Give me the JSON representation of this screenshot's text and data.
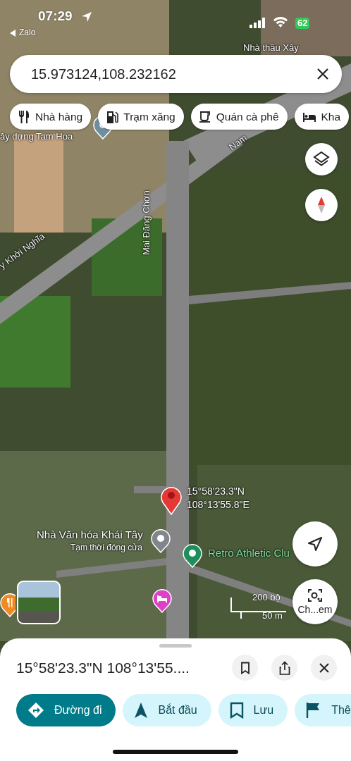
{
  "status_bar": {
    "time": "07:29",
    "back_label": "Zalo",
    "battery": "62"
  },
  "search": {
    "value": "15.973124,108.232162"
  },
  "chips": [
    {
      "kind": "restaurant",
      "label": "Nhà hàng"
    },
    {
      "kind": "gas",
      "label": "Trạm xăng"
    },
    {
      "kind": "cafe",
      "label": "Quán cà phê"
    },
    {
      "kind": "hotel",
      "label": "Kha"
    }
  ],
  "map": {
    "labels": [
      {
        "kind": "place",
        "text": "Nhà thầu Xây"
      },
      {
        "kind": "place",
        "text": "ây dựng Tam Hoa"
      },
      {
        "kind": "road",
        "text": "y Khởi Nghĩa"
      },
      {
        "kind": "road",
        "text": "Mai Đăng Chơn"
      },
      {
        "kind": "road",
        "text": "Nam"
      }
    ],
    "pins": [
      {
        "kind": "poi",
        "color": "#6f8ea0"
      },
      {
        "kind": "restaurant",
        "color": "#f08a24"
      },
      {
        "kind": "hotel",
        "color": "#e040c8"
      }
    ],
    "places": [
      {
        "name": "Nhà Văn hóa Khái Tây",
        "status": "Tạm thời đóng cửa",
        "color": "#80868b"
      },
      {
        "name": "Retro Athletic Clu",
        "color": "#1e8e5a"
      }
    ],
    "dropped_pin": {
      "lat": "15°58'23.3\"N",
      "lng": "108°13'55.8\"E"
    },
    "scale": {
      "imperial": "200 bộ",
      "metric": "50 m"
    },
    "camera_label": "Ch...em"
  },
  "sheet": {
    "title": "15°58'23.3\"N 108°13'55....",
    "actions": [
      {
        "kind": "directions",
        "label": "Đường đi",
        "primary": true
      },
      {
        "kind": "start",
        "label": "Bắt đầu",
        "primary": false
      },
      {
        "kind": "save",
        "label": "Lưu",
        "primary": false
      },
      {
        "kind": "flag",
        "label": "Thê",
        "primary": false
      }
    ]
  }
}
